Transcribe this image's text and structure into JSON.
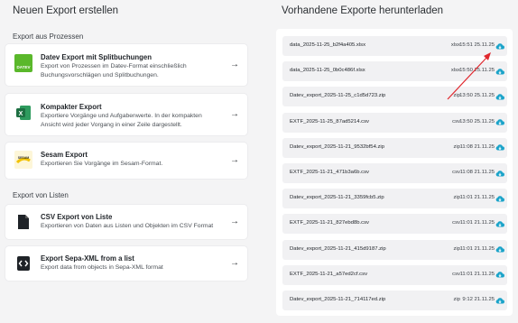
{
  "left": {
    "heading": "Neuen Export erstellen",
    "section_process": "Export aus Prozessen",
    "section_lists": "Export von Listen",
    "cards": [
      {
        "title": "Datev Export mit Splitbuchungen",
        "desc": "Export von Prozessen im Datev-Format einschließlich Buchungsvorschlägen und Splitbuchungen.",
        "logo_text": "DATEV",
        "icon": "datev-logo"
      },
      {
        "title": "Kompakter Export",
        "desc": "Exportiere Vorgänge und Aufgabenwerte. In der kompakten Ansicht wird jeder Vorgang in einer Zeile dargestellt.",
        "logo_text": "X",
        "icon": "excel-icon"
      },
      {
        "title": "Sesam Export",
        "desc": "Exportieren Sie Vorgänge im Sesam-Format.",
        "logo_text": "SESAM",
        "icon": "sesam-logo"
      },
      {
        "title": "CSV Export von Liste",
        "desc": "Exportieren von Daten aus Listen und Objekten im CSV Format",
        "icon": "file-icon"
      },
      {
        "title": "Export Sepa-XML from a list",
        "desc": "Export data from objects in Sepa-XML format",
        "icon": "code-file-icon"
      }
    ],
    "arrow": "→"
  },
  "right": {
    "heading": "Vorhandene Exporte herunterladen",
    "files": [
      {
        "name": "data_2025-11-25_b2f4a405.xlsx",
        "type": "xlsx",
        "time": "15:51 25.11.25"
      },
      {
        "name": "data_2025-11-25_0b0c486f.xlsx",
        "type": "xlsx",
        "time": "15:50 25.11.25"
      },
      {
        "name": "Datev_export_2025-11-25_c1d5d723.zip",
        "type": "zip",
        "time": "13:50 25.11.25"
      },
      {
        "name": "EXTF_2025-11-25_87ad5214.csv",
        "type": "csv",
        "time": "13:50 25.11.25"
      },
      {
        "name": "Datev_export_2025-11-21_9532bf54.zip",
        "type": "zip",
        "time": "11:08 21.11.25"
      },
      {
        "name": "EXTF_2025-11-21_471b3a6b.csv",
        "type": "csv",
        "time": "11:08 21.11.25"
      },
      {
        "name": "Datev_export_2025-11-21_3359fcb5.zip",
        "type": "zip",
        "time": "11:01 21.11.25"
      },
      {
        "name": "EXTF_2025-11-21_827ebd8b.csv",
        "type": "csv",
        "time": "11:01 21.11.25"
      },
      {
        "name": "Datev_export_2025-11-21_415d9187.zip",
        "type": "zip",
        "time": "11:01 21.11.25"
      },
      {
        "name": "EXTF_2025-11-21_a57ed2cf.csv",
        "type": "csv",
        "time": "11:01 21.11.25"
      },
      {
        "name": "Datev_export_2025-11-21_714117ed.zip",
        "type": "zip",
        "time": "9:12 21.11.25"
      }
    ],
    "download_icon": "cloud-download-icon"
  },
  "colors": {
    "accent": "#1aa3c9",
    "datev": "#5ab82b",
    "excel": "#1d6f42",
    "annotation": "#e0282e"
  }
}
